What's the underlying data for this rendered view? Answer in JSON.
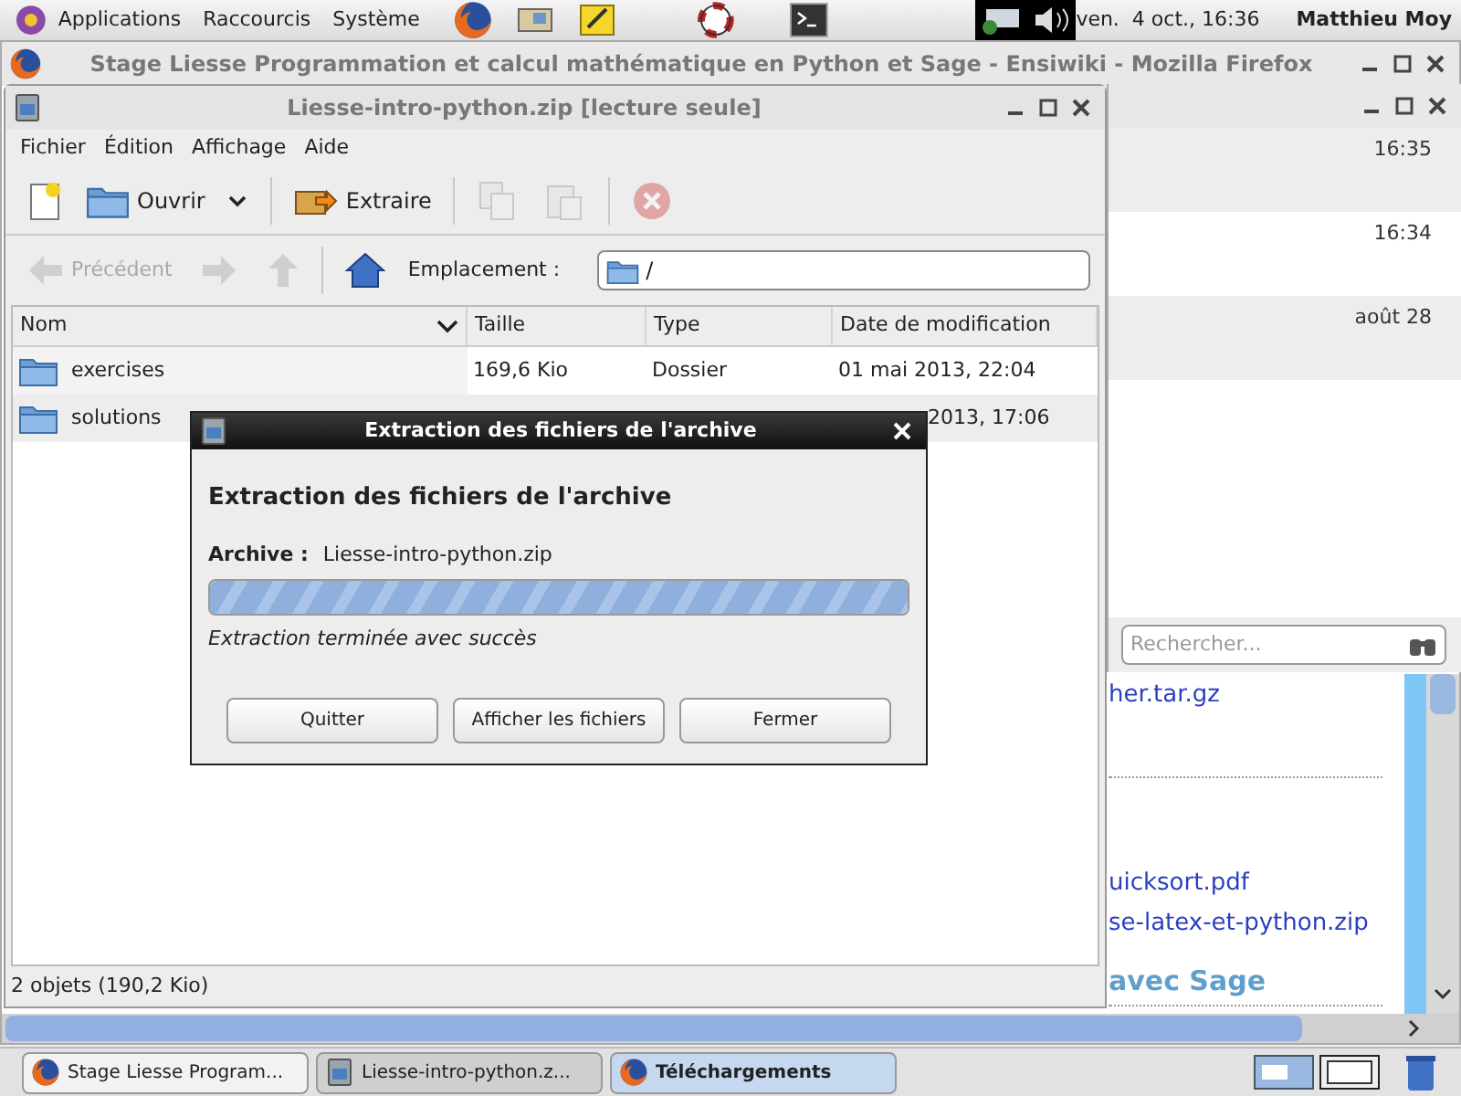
{
  "top_panel": {
    "menus": [
      "Applications",
      "Raccourcis",
      "Système"
    ],
    "clock": "ven.  4 oct., 16:36",
    "user": "Matthieu Moy"
  },
  "browser": {
    "title": "Stage Liesse Programmation et calcul mathématique en Python et Sage - Ensiwiki - Mozilla Firefox",
    "links": [
      "her.tar.gz",
      "uicksort.pdf",
      "se-latex-et-python.zip"
    ],
    "heading": "avec Sage"
  },
  "downloads": {
    "rows": [
      {
        "time": "16:35"
      },
      {
        "time": "16:34"
      },
      {
        "time": "août 28"
      }
    ],
    "search": {
      "placeholder": "Rechercher..."
    }
  },
  "archive": {
    "title": "Liesse-intro-python.zip [lecture seule]",
    "menu": [
      "Fichier",
      "Édition",
      "Affichage",
      "Aide"
    ],
    "toolbar": [
      {
        "kind": "new",
        "disabled": false
      },
      {
        "kind": "open",
        "label": "Ouvrir",
        "disabled": false
      },
      {
        "kind": "extract",
        "label": "Extraire",
        "disabled": false
      },
      {
        "kind": "copy",
        "disabled": true
      },
      {
        "kind": "paste",
        "disabled": true
      },
      {
        "kind": "stop",
        "disabled": true
      }
    ],
    "nav": [
      {
        "kind": "back",
        "label": "Précédent",
        "disabled": true
      },
      {
        "kind": "forward",
        "disabled": true
      },
      {
        "kind": "up",
        "disabled": true
      },
      {
        "kind": "home",
        "disabled": false
      }
    ],
    "location": {
      "label": "Emplacement :",
      "value": "/"
    },
    "columns": [
      "Nom",
      "Taille",
      "Type",
      "Date de modification"
    ],
    "rows": [
      {
        "name": "exercises",
        "size": "169,6 Kio",
        "type": "Dossier",
        "date": "01 mai 2013, 22:04"
      },
      {
        "name": "solutions",
        "date": "2013, 17:06"
      }
    ],
    "status": "2 objets (190,2 Kio)"
  },
  "dialog": {
    "title": "Extraction des fichiers de l'archive",
    "heading": "Extraction des fichiers de l'archive",
    "archive_label": "Archive :",
    "archive_name": "Liesse-intro-python.zip",
    "progress": {
      "level": 1
    },
    "status": "Extraction terminée avec succès",
    "buttons": [
      "Quitter",
      "Afficher les fichiers",
      "Fermer"
    ]
  },
  "taskbar": {
    "tasks": [
      {
        "label": "Stage Liesse Program...",
        "selected": false,
        "attention": false
      },
      {
        "label": "Liesse-intro-python.z...",
        "selected": true,
        "attention": false
      },
      {
        "label": "Téléchargements",
        "selected": false,
        "attention": true
      }
    ]
  }
}
